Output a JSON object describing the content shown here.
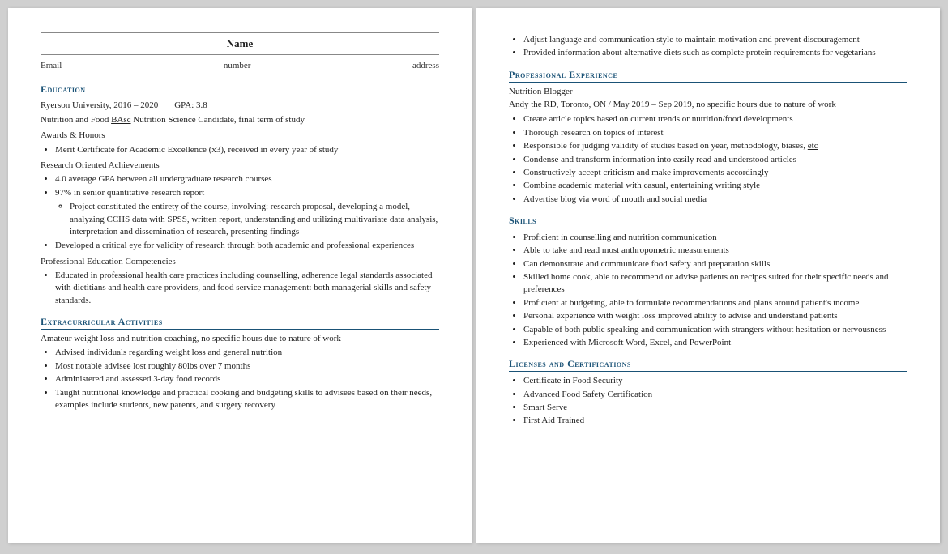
{
  "page1": {
    "header": {
      "name": "Name",
      "email": "Email",
      "phone": "number",
      "address": "address"
    },
    "education": {
      "heading": "Education",
      "university": "Ryerson University, 2016 – 2020",
      "gpa": "GPA: 3.8",
      "program": "Nutrition and Food ",
      "program_underline": "BAsc",
      "program_rest": " Nutrition Science Candidate, final term of study",
      "awards_heading": "Awards & Honors",
      "awards_items": [
        "Merit Certificate for Academic Excellence (x3), received in every year of study"
      ],
      "research_heading": "Research Oriented Achievements",
      "research_items": [
        "4.0 average GPA between all undergraduate research courses",
        "97% in senior quantitative research report"
      ],
      "research_sub_items": [
        "Project constituted the entirety of the course, involving: research proposal, developing a model, analyzing CCHS data with SPSS, written report, understanding and utilizing multivariate data analysis, interpretation and dissemination of research, presenting findings"
      ],
      "research_item3": "Developed a critical eye for validity of research through both academic and professional experiences",
      "competencies_heading": "Professional Education Competencies",
      "competencies_items": [
        "Educated in professional health care practices including counselling, adherence legal standards associated with dietitians and health care providers, and food service management: both managerial skills and safety standards."
      ]
    },
    "extracurricular": {
      "heading": "Extracurricular Activities",
      "description": "Amateur weight loss and nutrition coaching, no specific hours due to nature of work",
      "items": [
        "Advised individuals regarding weight loss and general nutrition",
        "Most notable advisee lost roughly 80lbs over 7 months",
        "Administered and assessed 3-day food records",
        "Taught nutritional knowledge and practical cooking and budgeting skills to advisees based on their needs, examples include students, new parents, and surgery recovery"
      ]
    }
  },
  "page2": {
    "bullet_intro": [
      "Adjust language and communication style to maintain motivation and prevent discouragement",
      "Provided information about alternative diets such as complete protein requirements for vegetarians"
    ],
    "professional_experience": {
      "heading": "Professional Experience",
      "job_title": "Nutrition Blogger",
      "job_org": "Andy the RD, Toronto, ON / May 2019 – Sep 2019, no specific hours due to nature of work",
      "items": [
        "Create article topics based on current trends or nutrition/food developments",
        "Thorough research on topics of interest",
        "Responsible for judging validity of studies based on year, methodology, biases, etc",
        "Condense and transform information into easily read and understood articles",
        "Constructively accept criticism and make improvements accordingly",
        "Combine academic material with casual, entertaining writing style",
        "Advertise blog via word of mouth and social media"
      ],
      "etc_underline_index": 2,
      "etc_word": "etc"
    },
    "skills": {
      "heading": "Skills",
      "items": [
        "Proficient in counselling and nutrition communication",
        "Able to take and read most anthropometric measurements",
        "Can demonstrate and communicate food safety and preparation skills",
        "Skilled home cook, able to recommend or advise patients on recipes suited for their specific needs and preferences",
        "Proficient at budgeting, able to formulate recommendations and plans around patient's income",
        "Personal experience with weight loss improved ability to advise and understand patients",
        "Capable of both public speaking and communication with strangers without hesitation or nervousness",
        "Experienced with Microsoft Word, Excel, and PowerPoint"
      ]
    },
    "licenses": {
      "heading": "Licenses and Certifications",
      "items": [
        "Certificate in Food Security",
        "Advanced Food Safety Certification",
        "Smart Serve",
        "First Aid Trained"
      ]
    }
  }
}
